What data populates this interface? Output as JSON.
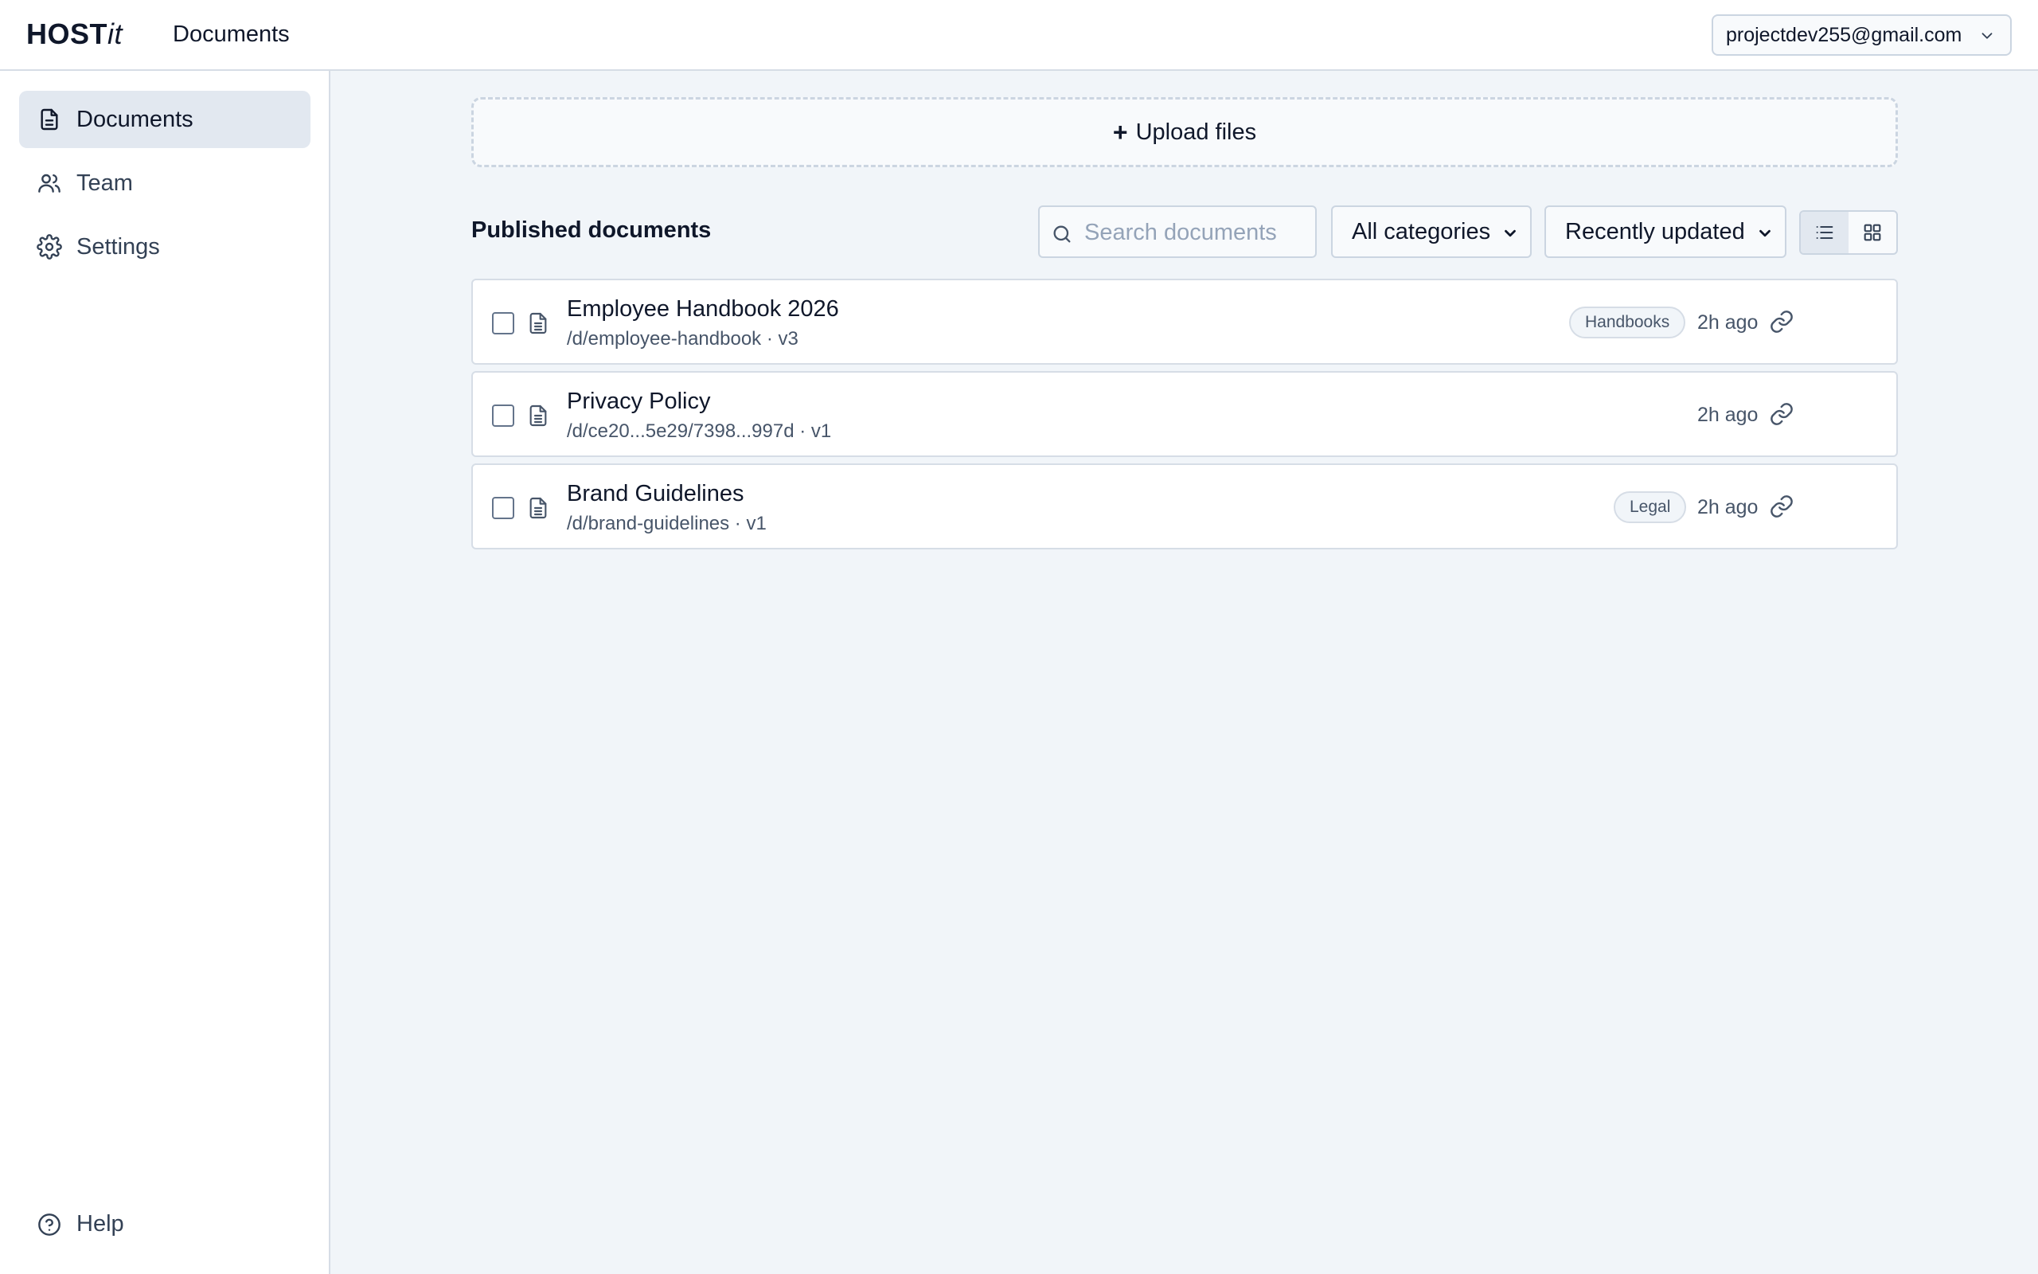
{
  "brand": {
    "logo_bold": "HOST",
    "logo_italic": "it"
  },
  "header": {
    "title": "Documents",
    "account_email": "projectdev255@gmail.com"
  },
  "sidebar": {
    "items": [
      {
        "label": "Documents",
        "icon": "document-icon",
        "active": true
      },
      {
        "label": "Team",
        "icon": "users-icon",
        "active": false
      },
      {
        "label": "Settings",
        "icon": "gear-icon",
        "active": false
      }
    ],
    "help_label": "Help"
  },
  "main": {
    "upload_label": "Upload files",
    "section_title": "Published documents",
    "search_placeholder": "Search documents",
    "category_filter": "All categories",
    "sort_filter": "Recently updated",
    "view_mode": "list",
    "documents": [
      {
        "name": "Employee Handbook 2026",
        "path": "/d/employee-handbook · v3",
        "category": "Handbooks",
        "updated": "2h ago"
      },
      {
        "name": "Privacy Policy",
        "path": "/d/ce20...5e29/7398...997d · v1",
        "category": "",
        "updated": "2h ago"
      },
      {
        "name": "Brand Guidelines",
        "path": "/d/brand-guidelines · v1",
        "category": "Legal",
        "updated": "2h ago"
      }
    ]
  },
  "colors": {
    "accent": "#0f172a",
    "background": "#f1f5f9",
    "border": "#d6dde6",
    "muted_text": "#475569"
  }
}
